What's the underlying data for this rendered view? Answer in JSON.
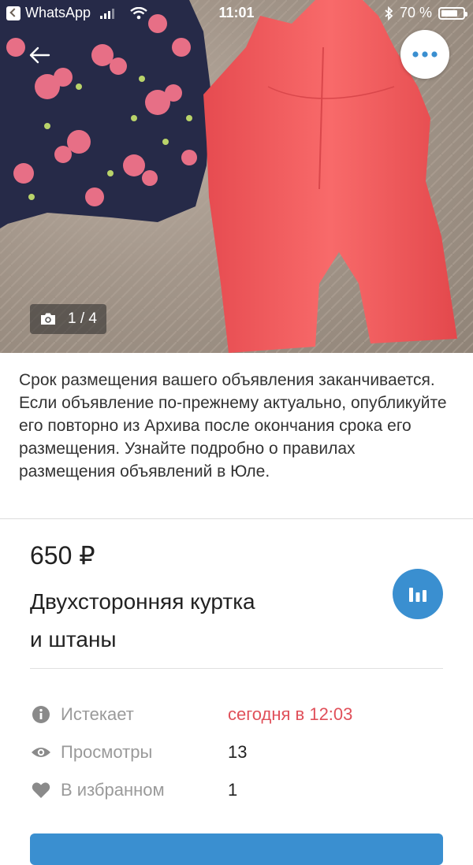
{
  "status_bar": {
    "back_app": "WhatsApp",
    "time": "11:01",
    "battery": "70 %"
  },
  "photo": {
    "counter": "1 / 4"
  },
  "notice": {
    "text": "Срок размещения вашего объявления заканчивается. Если объявление по-прежнему актуально, опубликуйте его повторно из Архива после окончания срока его размещения. Узнайте подробно о правилах размещения объявлений в Юле."
  },
  "listing": {
    "price": "650 ₽",
    "title_line1": "Двухсторонняя куртка",
    "title_line2": "и штаны"
  },
  "info": {
    "expires_label": "Истекает",
    "expires_value": "сегодня в 12:03",
    "views_label": "Просмотры",
    "views_value": "13",
    "favorites_label": "В избранном",
    "favorites_value": "1"
  },
  "colors": {
    "accent": "#3a8fd0",
    "alert": "#e0505a",
    "jacket": "#262a48",
    "pants": "#f0575a"
  },
  "icons": {
    "back": "arrow-left-icon",
    "more": "more-dots-icon",
    "camera": "camera-icon",
    "stats": "bar-chart-icon",
    "info": "info-icon",
    "views": "eye-icon",
    "favorites": "heart-icon"
  }
}
